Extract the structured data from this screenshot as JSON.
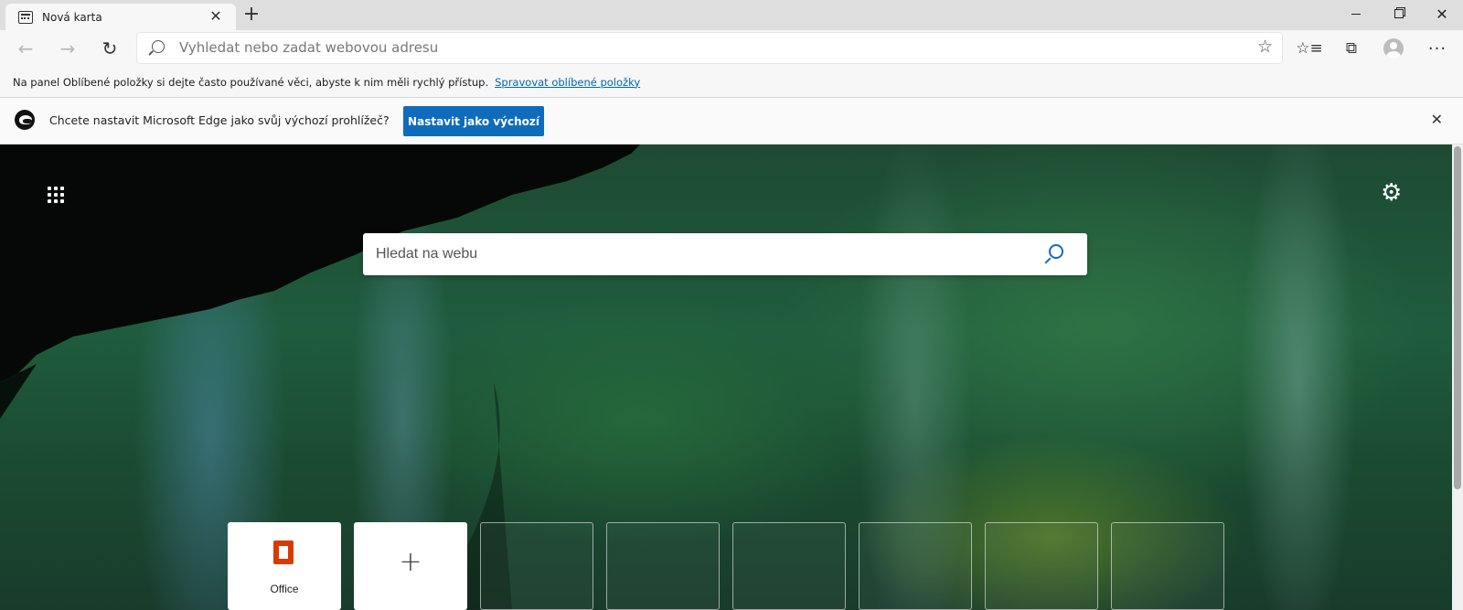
{
  "tab": {
    "title": "Nová karta",
    "close": "✕",
    "new_tab": "+"
  },
  "window": {
    "close": "✕"
  },
  "toolbar": {
    "back": "←",
    "forward": "→",
    "refresh": "↻",
    "address_placeholder": "Vyhledat nebo zadat webovou adresu",
    "favorite": "☆",
    "favorites_list": "☆≡",
    "collections": "⧉",
    "more": "···"
  },
  "favbar": {
    "text": "Na panel Oblíbené položky si dejte často používané věci, abyste k nim měli rychlý přístup.",
    "link": "Spravovat oblíbené položky"
  },
  "infobar": {
    "text": "Chcete nastavit Microsoft Edge jako svůj výchozí prohlížeč?",
    "button": "Nastavit jako výchozí",
    "close": "✕"
  },
  "ntp": {
    "search_placeholder": "Hledat na webu",
    "settings": "⚙",
    "tiles": [
      {
        "label": "Office",
        "kind": "office"
      },
      {
        "label": "+",
        "kind": "add"
      }
    ]
  },
  "colors": {
    "accent": "#0f6cbd",
    "office": "#d83b01",
    "link": "#0066b4"
  }
}
